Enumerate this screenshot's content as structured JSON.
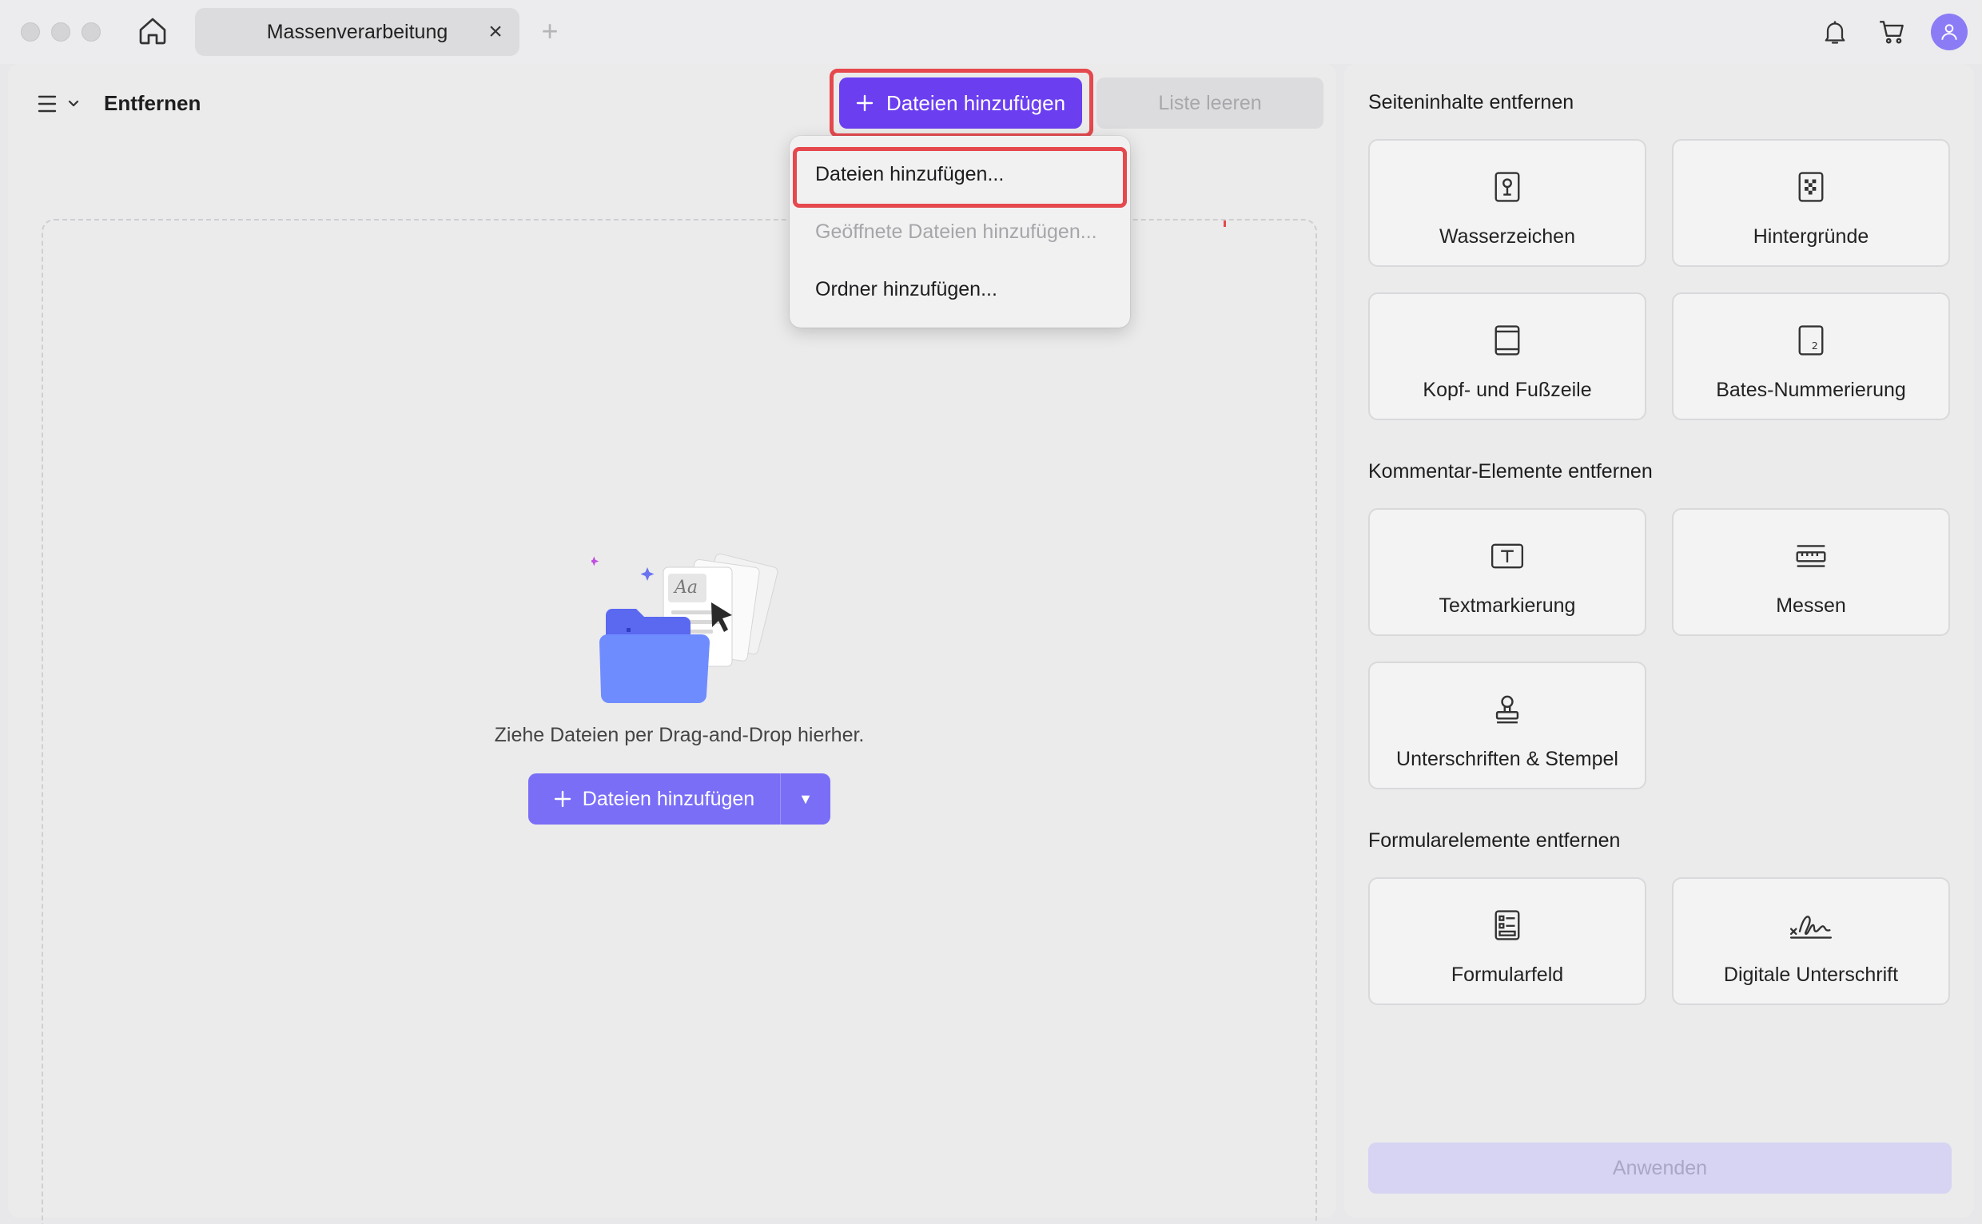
{
  "tab": {
    "title": "Massenverarbeitung",
    "close": "×",
    "add": "+"
  },
  "left": {
    "title": "Entfernen",
    "add_button": "Dateien hinzufügen",
    "clear_button": "Liste leeren",
    "drop_text": "Ziehe Dateien per Drag-and-Drop hierher.",
    "center_button": "Dateien hinzufügen"
  },
  "dropdown": {
    "items": [
      "Dateien hinzufügen...",
      "Geöffnete Dateien hinzufügen...",
      "Ordner hinzufügen..."
    ]
  },
  "right": {
    "sections": [
      {
        "title": "Seiteninhalte entfernen"
      },
      {
        "title": "Kommentar-Elemente entfernen"
      },
      {
        "title": "Formularelemente entfernen"
      }
    ],
    "cards": [
      {
        "label": "Wasserzeichen",
        "icon": "watermark-icon"
      },
      {
        "label": "Hintergründe",
        "icon": "background-icon"
      },
      {
        "label": "Kopf- und Fußzeile",
        "icon": "header-footer-icon"
      },
      {
        "label": "Bates-Nummerierung",
        "icon": "bates-number-icon"
      },
      {
        "label": "Textmarkierung",
        "icon": "text-markup-icon"
      },
      {
        "label": "Messen",
        "icon": "measure-icon"
      },
      {
        "label": "Unterschriften & Stempel",
        "icon": "stamp-icon"
      },
      {
        "label": "Formularfeld",
        "icon": "form-field-icon"
      },
      {
        "label": "Digitale Unterschrift",
        "icon": "digital-signature-icon"
      }
    ],
    "apply_button": "Anwenden"
  },
  "colors": {
    "accent": "#6b3ef0",
    "highlight": "#e5484d",
    "avatar": "#8b7cf6"
  }
}
